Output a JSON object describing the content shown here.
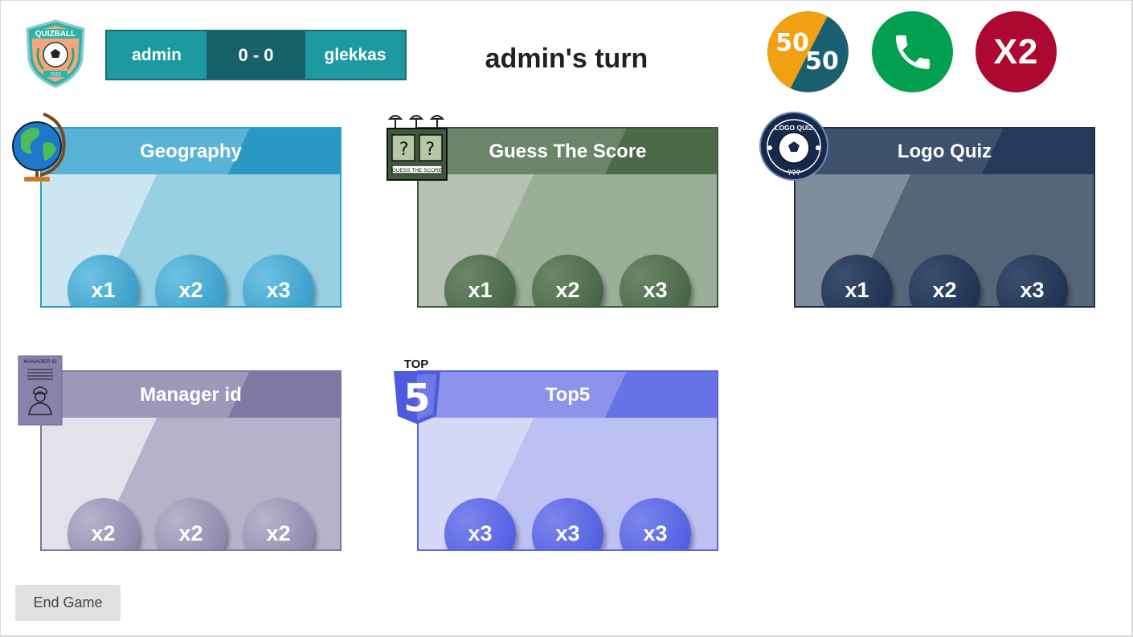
{
  "scoreboard": {
    "player1": "admin",
    "score": "0 - 0",
    "player2": "glekkas"
  },
  "turn_text": "admin's turn",
  "brand": {
    "logo_text": "QUIZBALL",
    "logo_year": "2023"
  },
  "lifelines": {
    "fifty_top": "50",
    "fifty_bottom": "50",
    "phone_icon": "phone-icon",
    "double_label": "X2"
  },
  "categories": [
    {
      "name": "Geography",
      "icon": "globe-icon",
      "buttons": [
        "x1",
        "x2",
        "x3"
      ]
    },
    {
      "name": "Guess The Score",
      "icon": "scoreboard-icon",
      "icon_text": "? ?",
      "icon_caption": "GUESS THE SCORE",
      "buttons": [
        "x1",
        "x2",
        "x3"
      ]
    },
    {
      "name": "Logo Quiz",
      "icon": "logo-quiz-badge-icon",
      "icon_title": "LOGO QUIZ",
      "icon_caption": "???",
      "buttons": [
        "x1",
        "x2",
        "x3"
      ]
    },
    {
      "name": "Manager id",
      "icon": "manager-id-card-icon",
      "icon_title": "MANAGER ID",
      "buttons": [
        "x2",
        "x2",
        "x2"
      ]
    },
    {
      "name": "Top5",
      "icon": "top5-shield-icon",
      "icon_title": "TOP",
      "icon_number": "5",
      "buttons": [
        "x3",
        "x3",
        "x3"
      ]
    }
  ],
  "colors": {
    "scoreboard_player": "#1c9aa0",
    "scoreboard_score": "#14616a",
    "fifty_orange": "#f0a012",
    "fifty_teal": "#1a5f6e",
    "phone_green": "#03a04f",
    "double_red": "#ad0831"
  },
  "end_game_label": "End Game"
}
